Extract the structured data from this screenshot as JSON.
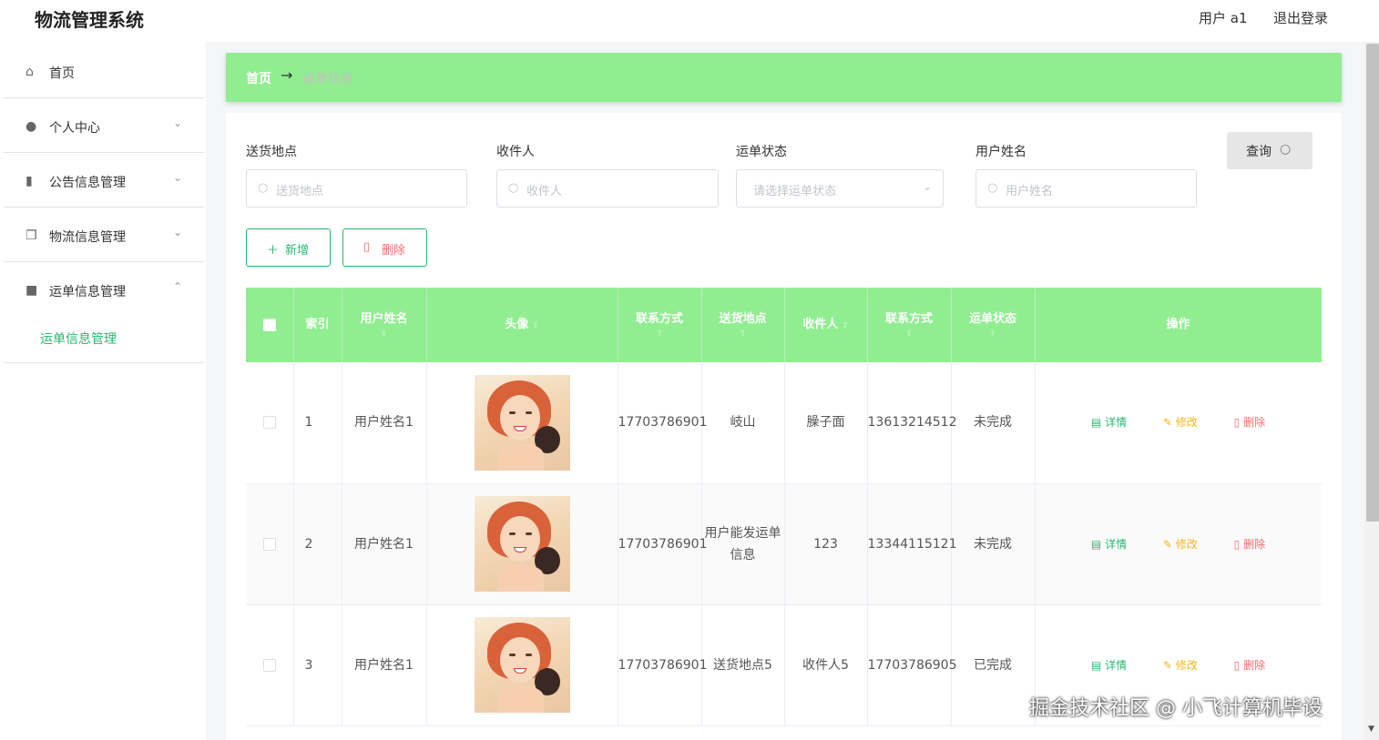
{
  "header": {
    "app_title": "物流管理系统",
    "user": "用户 a1",
    "logout": "退出登录"
  },
  "sidebar": {
    "items": [
      {
        "label": "首页",
        "icon": "home-icon"
      },
      {
        "label": "个人中心",
        "icon": "user-icon"
      },
      {
        "label": "公告信息管理",
        "icon": "chart-icon"
      },
      {
        "label": "物流信息管理",
        "icon": "copy-icon"
      },
      {
        "label": "运单信息管理",
        "icon": "video-icon"
      }
    ],
    "sub_item": "运单信息管理"
  },
  "breadcrumb": {
    "home": "首页",
    "arrow": "→",
    "current": "运单信息"
  },
  "filters": {
    "address_label": "送货地点",
    "address_placeholder": "送货地点",
    "receiver_label": "收件人",
    "receiver_placeholder": "收件人",
    "status_label": "运单状态",
    "status_placeholder": "请选择运单状态",
    "username_label": "用户姓名",
    "username_placeholder": "用户姓名",
    "query_button": "查询"
  },
  "actions": {
    "add": "新增",
    "delete": "删除"
  },
  "table": {
    "headers": [
      "索引",
      "用户姓名",
      "头像",
      "联系方式",
      "送货地点",
      "收件人",
      "联系方式",
      "运单状态",
      "操作"
    ],
    "rows": [
      {
        "index": "1",
        "username": "用户姓名1",
        "phone": "17703786901",
        "address": "岐山",
        "receiver": "臊子面",
        "receiver_phone": "13613214512",
        "status": "未完成"
      },
      {
        "index": "2",
        "username": "用户姓名1",
        "phone": "17703786901",
        "address": "用户能发运单信息",
        "receiver": "123",
        "receiver_phone": "13344115121",
        "status": "未完成"
      },
      {
        "index": "3",
        "username": "用户姓名1",
        "phone": "17703786901",
        "address": "送货地点5",
        "receiver": "收件人5",
        "receiver_phone": "17703786905",
        "status": "已完成"
      }
    ],
    "ops": {
      "detail": "详情",
      "edit": "修改",
      "delete": "删除"
    }
  },
  "watermark": "掘金技术社区 @ 小飞计算机毕设",
  "colors": {
    "accent_green": "#90ee90",
    "link_green": "#2bb673",
    "edit_yellow": "#f3b61f",
    "delete_red": "#f56c6c"
  }
}
